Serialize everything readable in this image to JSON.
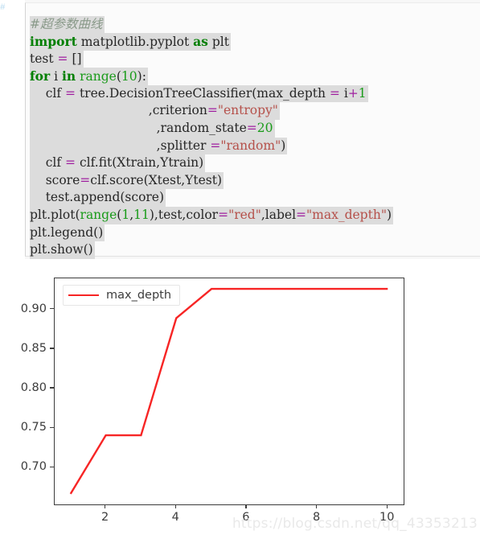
{
  "code": {
    "gutter_mark": "#",
    "language": "python",
    "lines": [
      [
        {
          "t": "#超参数曲线",
          "c": "cmt"
        }
      ],
      [
        {
          "t": "import",
          "c": "kw"
        },
        {
          "t": " matplotlib.pyplot ",
          "c": "txt"
        },
        {
          "t": "as",
          "c": "kw"
        },
        {
          "t": " plt",
          "c": "txt"
        }
      ],
      [
        {
          "t": "test ",
          "c": "txt"
        },
        {
          "t": "=",
          "c": "op"
        },
        {
          "t": " []",
          "c": "txt"
        }
      ],
      [
        {
          "t": "for",
          "c": "kw"
        },
        {
          "t": " i ",
          "c": "txt"
        },
        {
          "t": "in",
          "c": "kw"
        },
        {
          "t": " ",
          "c": "txt"
        },
        {
          "t": "range",
          "c": "num"
        },
        {
          "t": "(",
          "c": "txt"
        },
        {
          "t": "10",
          "c": "num"
        },
        {
          "t": "):",
          "c": "txt"
        }
      ],
      [
        {
          "t": "    clf ",
          "c": "txt"
        },
        {
          "t": "=",
          "c": "op"
        },
        {
          "t": " tree.DecisionTreeClassifier(max_depth ",
          "c": "txt"
        },
        {
          "t": "=",
          "c": "op"
        },
        {
          "t": " i",
          "c": "txt"
        },
        {
          "t": "+",
          "c": "op"
        },
        {
          "t": "1",
          "c": "num"
        }
      ],
      [
        {
          "t": "                              ,criterion",
          "c": "txt"
        },
        {
          "t": "=",
          "c": "op"
        },
        {
          "t": "\"entropy\"",
          "c": "str"
        }
      ],
      [
        {
          "t": "                                ,random_state",
          "c": "txt"
        },
        {
          "t": "=",
          "c": "op"
        },
        {
          "t": "20",
          "c": "num"
        }
      ],
      [
        {
          "t": "                                ,splitter ",
          "c": "txt"
        },
        {
          "t": "=",
          "c": "op"
        },
        {
          "t": "\"random\"",
          "c": "str"
        },
        {
          "t": ")",
          "c": "txt"
        }
      ],
      [
        {
          "t": "    clf ",
          "c": "txt"
        },
        {
          "t": "=",
          "c": "op"
        },
        {
          "t": " clf.fit(Xtrain,Ytrain)",
          "c": "txt"
        }
      ],
      [
        {
          "t": "    score",
          "c": "txt"
        },
        {
          "t": "=",
          "c": "op"
        },
        {
          "t": "clf.score(Xtest,Ytest)",
          "c": "txt"
        }
      ],
      [
        {
          "t": "    test.append(score)",
          "c": "txt"
        }
      ],
      [
        {
          "t": "plt.plot(",
          "c": "txt"
        },
        {
          "t": "range",
          "c": "num"
        },
        {
          "t": "(",
          "c": "txt"
        },
        {
          "t": "1",
          "c": "num"
        },
        {
          "t": ",",
          "c": "txt"
        },
        {
          "t": "11",
          "c": "num"
        },
        {
          "t": "),test,color",
          "c": "txt"
        },
        {
          "t": "=",
          "c": "op"
        },
        {
          "t": "\"red\"",
          "c": "str"
        },
        {
          "t": ",label",
          "c": "txt"
        },
        {
          "t": "=",
          "c": "op"
        },
        {
          "t": "\"max_depth\"",
          "c": "str"
        },
        {
          "t": ")",
          "c": "txt"
        }
      ],
      [
        {
          "t": "plt.legend()",
          "c": "txt"
        }
      ],
      [
        {
          "t": "plt.show()",
          "c": "txt"
        }
      ]
    ]
  },
  "chart_data": {
    "type": "line",
    "title": "",
    "xlabel": "",
    "ylabel": "",
    "x": [
      1,
      2,
      3,
      4,
      5,
      6,
      7,
      8,
      9,
      10
    ],
    "series": [
      {
        "name": "max_depth",
        "color": "#f72525",
        "values": [
          0.667,
          0.741,
          0.741,
          0.889,
          0.926,
          0.926,
          0.926,
          0.926,
          0.926,
          0.926
        ]
      }
    ],
    "xlim": [
      0.55,
      10.45
    ],
    "ylim": [
      0.6537,
      0.9393
    ],
    "xticks": [
      "2",
      "4",
      "6",
      "8",
      "10"
    ],
    "xtick_values": [
      2,
      4,
      6,
      8,
      10
    ],
    "yticks": [
      "0.70",
      "0.75",
      "0.80",
      "0.85",
      "0.90"
    ],
    "ytick_values": [
      0.7,
      0.75,
      0.8,
      0.85,
      0.9
    ],
    "grid": false,
    "legend_position": "upper left",
    "legend_entries": [
      "max_depth"
    ]
  },
  "watermark": {
    "text": "https://blog.csdn.net/qq_43353213"
  }
}
